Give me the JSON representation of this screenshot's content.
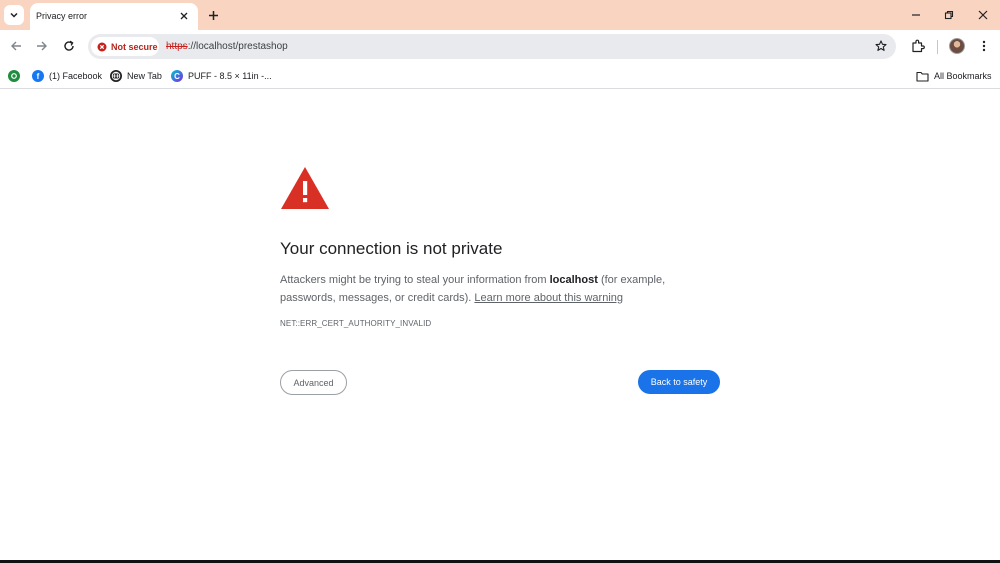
{
  "browser": {
    "tab": {
      "title": "Privacy error"
    },
    "omnibox": {
      "security_chip": "Not secure",
      "url_scheme": "https",
      "url_rest": "://localhost/prestashop"
    },
    "bookmarks": [
      {
        "label": "",
        "icon": "green-app-icon"
      },
      {
        "label": "(1) Facebook",
        "icon": "facebook-icon"
      },
      {
        "label": "New Tab",
        "icon": "globe-icon"
      },
      {
        "label": "PUFF - 8.5 × 11in -...",
        "icon": "canva-icon"
      }
    ],
    "all_bookmarks": "All Bookmarks"
  },
  "page": {
    "heading": "Your connection is not private",
    "desc_prefix": "Attackers might be trying to steal your information from ",
    "desc_host": "localhost",
    "desc_suffix": " (for example, passwords, messages, or credit cards). ",
    "learn_more": "Learn more about this warning",
    "error_code": "NET::ERR_CERT_AUTHORITY_INVALID",
    "advanced_button": "Advanced",
    "back_button": "Back to safety"
  },
  "colors": {
    "tabstrip": "#f8d4c1",
    "primary": "#1a73e8",
    "warning": "#d93025"
  }
}
